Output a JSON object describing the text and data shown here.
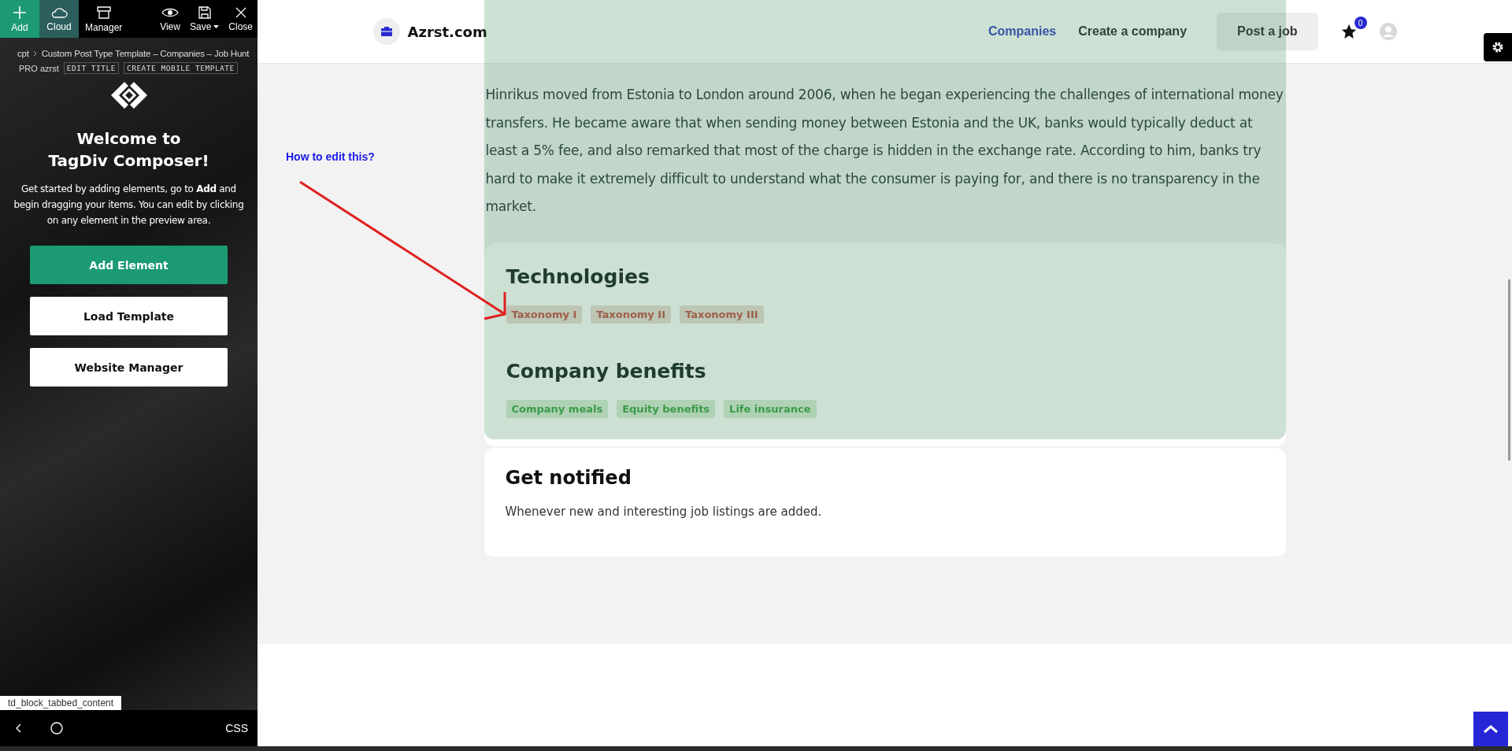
{
  "toolbar": {
    "buttons": [
      {
        "label": "Add",
        "kind": "primary"
      },
      {
        "label": "Cloud",
        "kind": "active"
      },
      {
        "label": "Manager",
        "kind": "plain"
      }
    ],
    "right_buttons": [
      {
        "label": "View",
        "kind": "view"
      },
      {
        "label": "Save",
        "kind": "save"
      },
      {
        "label": "Close",
        "kind": "close"
      }
    ]
  },
  "breadcrumb": {
    "root": "cpt",
    "title": "Custom Post Type Template – Companies – Job Hunt"
  },
  "template_actions": {
    "user": "PRO azrst",
    "buttons": [
      "EDIT TITLE",
      "CREATE MOBILE TEMPLATE"
    ]
  },
  "welcome": {
    "title_line_1": "Welcome to",
    "title_line_2": "TagDiv Composer!",
    "text": "Get started by adding elements, go to **Add** and begin dragging your items. You can edit by clicking on any element in the preview area."
  },
  "actions": [
    {
      "label": "Add Element",
      "kind": "primary"
    },
    {
      "label": "Load Template",
      "kind": "secondary"
    },
    {
      "label": "Website Manager",
      "kind": "secondary"
    }
  ],
  "element_label": "td_block_tabbed_content",
  "bottom_bar": {
    "css_label": "CSS"
  },
  "site": {
    "name": "Azrst.com",
    "nav": [
      {
        "label": "Companies",
        "selected": true
      },
      {
        "label": "Create a company",
        "selected": false
      }
    ],
    "post_button": "Post a job",
    "favorites_count": "0"
  },
  "hint": {
    "text": "How to edit this?"
  },
  "article": {
    "text": "Hinrikus moved from Estonia to London around 2006, when he began experiencing the challenges of international money transfers. He became aware that when sending money between Estonia and the UK, banks would typically deduct at least a 5% fee, and also remarked that most of the charge is hidden in the exchange rate. According to him, banks try hard to make it extremely difficult to understand what the consumer is paying for, and there is no transparency in the market."
  },
  "sections": [
    {
      "title": "Technologies",
      "kind": "technology",
      "tags": [
        "Taxonomy I",
        "Taxonomy II",
        "Taxonomy III"
      ]
    },
    {
      "title": "Company benefits",
      "kind": "benefit",
      "tags": [
        "Company meals",
        "Equity benefits",
        "Life insurance"
      ]
    }
  ],
  "notify": {
    "title": "Get notified",
    "text": "Whenever new and interesting job listings are added."
  }
}
